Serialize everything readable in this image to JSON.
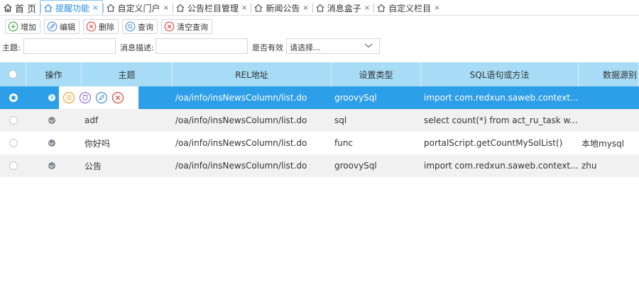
{
  "tabs": [
    {
      "label": "首 页",
      "closable": false,
      "active": false
    },
    {
      "label": "提醒功能",
      "closable": true,
      "active": true
    },
    {
      "label": "自定义门户",
      "closable": true,
      "active": false
    },
    {
      "label": "公告栏目管理",
      "closable": true,
      "active": false
    },
    {
      "label": "新闻公告",
      "closable": true,
      "active": false
    },
    {
      "label": "消息盒子",
      "closable": true,
      "active": false
    },
    {
      "label": "自定义栏目",
      "closable": true,
      "active": false
    }
  ],
  "close_glyph": "×",
  "toolbar": {
    "add": "增加",
    "edit": "编辑",
    "delete": "删除",
    "query": "查询",
    "clear": "清空查询"
  },
  "search": {
    "subject_label": "主题:",
    "subject_value": "",
    "desc_label": "消息描述:",
    "desc_value": "",
    "valid_label": "是否有效",
    "valid_placeholder": "请选择..."
  },
  "grid": {
    "columns": [
      "操作",
      "主题",
      "REL地址",
      "设置类型",
      "SQL语句或方法",
      "数据源别"
    ],
    "rows": [
      {
        "subject": "",
        "url": "/oa/info/insNewsColumn/list.do",
        "type": "groovySql",
        "sql": "import com.redxun.saweb.context...",
        "ds": "",
        "selected": true
      },
      {
        "subject": "adf",
        "url": "/oa/info/insNewsColumn/list.do",
        "type": "sql",
        "sql": "select count(*) from act_ru_task w...",
        "ds": "",
        "selected": false
      },
      {
        "subject": "你好吗",
        "url": "/oa/info/insNewsColumn/list.do",
        "type": "func",
        "sql": "portalScript.getCountMySolList()",
        "ds": "本地mysql",
        "selected": false
      },
      {
        "subject": "公告",
        "url": "/oa/info/insNewsColumn/list.do",
        "type": "groovySql",
        "sql": "import com.redxun.saweb.context...",
        "ds": "zhu",
        "selected": false
      }
    ]
  },
  "colors": {
    "accent": "#2d9ee8",
    "header_bg": "#a7dbf6",
    "alt_row": "#f1f1f1",
    "btn_orange": "#f3a43b",
    "btn_purple": "#9b6ad6",
    "btn_blue": "#4a8ee0",
    "btn_red": "#e0433b"
  },
  "icons": [
    "home-icon",
    "plus-circle-icon",
    "edit-icon",
    "delete-icon",
    "search-icon",
    "clear-icon",
    "chevron-down-icon",
    "row-expander-icon",
    "detail-icon",
    "permission-icon"
  ]
}
